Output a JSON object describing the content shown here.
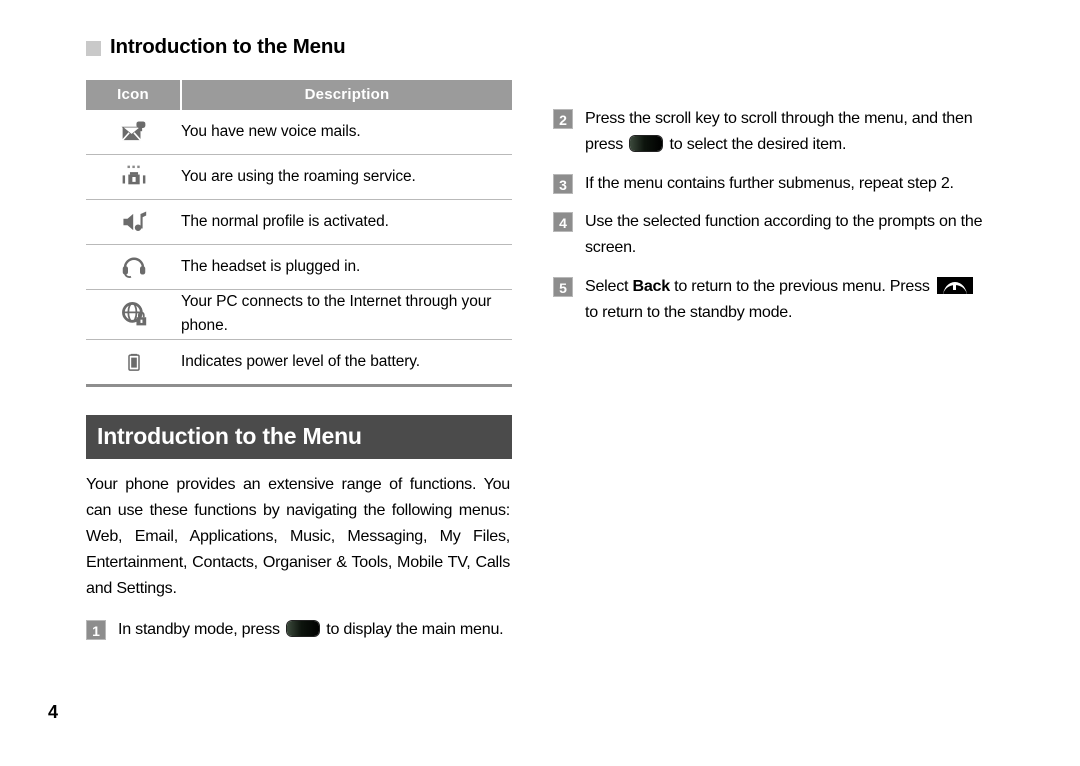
{
  "page": {
    "number": "4",
    "section_title": "Introduction to the Menu",
    "banner_title": "Introduction to the Menu"
  },
  "colors": {
    "table_header_bg": "#9b9b9b",
    "banner_bg": "#4b4b4b",
    "badge_bg": "#8d8d8d",
    "bullet_square": "#c9c9c9",
    "rule": "#b9b9b9",
    "rule_bottom": "#8e8e8e"
  },
  "icon_table": {
    "columns": [
      "Icon",
      "Description"
    ],
    "rows": [
      {
        "icon": "voice-mail-icon",
        "description": "You have new voice mails."
      },
      {
        "icon": "roaming-icon",
        "description": "You are using the roaming service."
      },
      {
        "icon": "normal-profile-speaker-icon",
        "description": "The normal profile is activated."
      },
      {
        "icon": "headset-icon",
        "description": "The headset is plugged in."
      },
      {
        "icon": "pc-internet-globe-lock-icon",
        "description": "Your PC connects to the Internet through your phone."
      },
      {
        "icon": "battery-icon",
        "description": "Indicates power level of the battery."
      }
    ]
  },
  "intro": {
    "paragraph": "Your phone provides an extensive range of functions. You can use these functions by navigating the following menus: Web, Email, Applications, Music, Messaging, My Files, Entertainment, Contacts, Organiser & Tools, Mobile TV, Calls and Settings."
  },
  "steps": {
    "left": [
      {
        "number": "1",
        "parts": [
          {
            "type": "text",
            "value": "In standby mode, press "
          },
          {
            "type": "key",
            "value": "ok-key-icon"
          },
          {
            "type": "text",
            "value": " to display the main menu."
          }
        ]
      }
    ],
    "right": [
      {
        "number": "2",
        "parts": [
          {
            "type": "text",
            "value": "Press the scroll key to scroll through the menu, and then press "
          },
          {
            "type": "key",
            "value": "ok-key-icon"
          },
          {
            "type": "text",
            "value": " to select the desired item."
          }
        ]
      },
      {
        "number": "3",
        "parts": [
          {
            "type": "text",
            "value": "If the menu contains further submenus, repeat step 2."
          }
        ]
      },
      {
        "number": "4",
        "parts": [
          {
            "type": "text",
            "value": "Use the selected function according to the prompts on the screen."
          }
        ]
      },
      {
        "number": "5",
        "parts": [
          {
            "type": "text",
            "value": "Select "
          },
          {
            "type": "bold",
            "value": "Back"
          },
          {
            "type": "text",
            "value": " to return to the previous menu. Press "
          },
          {
            "type": "key",
            "value": "end-call-key-icon"
          },
          {
            "type": "text",
            "value": " to return to the standby mode."
          }
        ]
      }
    ]
  }
}
